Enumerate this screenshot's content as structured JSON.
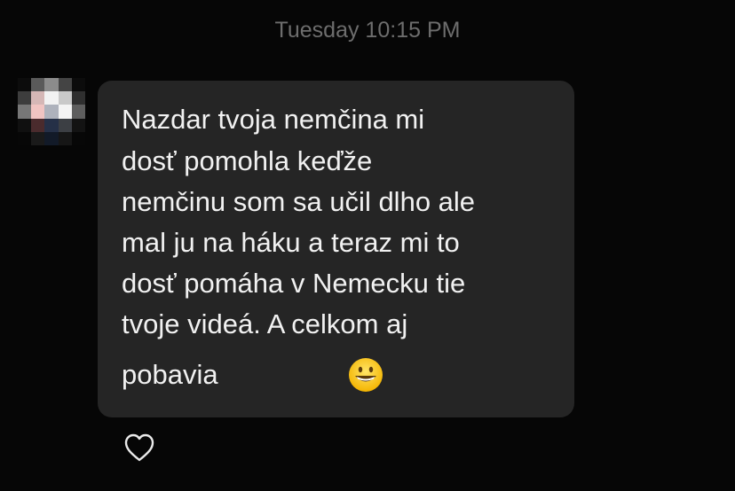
{
  "conversation": {
    "timestamp": "Tuesday 10:15 PM"
  },
  "message": {
    "lines": [
      "Nazdar tvoja nemčina mi",
      "dosť pomohla keďže",
      "nemčinu som sa učil dlho ale",
      "mal ju na háku a teraz mi to",
      "dosť pomáha v Nemecku tie",
      "tvoje videá. A celkom aj",
      "pobavia"
    ],
    "emoji": "grinning-face-emoji",
    "bubble_color": "#252525",
    "text_color": "#f1f1f1"
  },
  "sender": {
    "avatar": "pixelated-avatar"
  },
  "actions": {
    "like_icon": "heart-icon"
  }
}
